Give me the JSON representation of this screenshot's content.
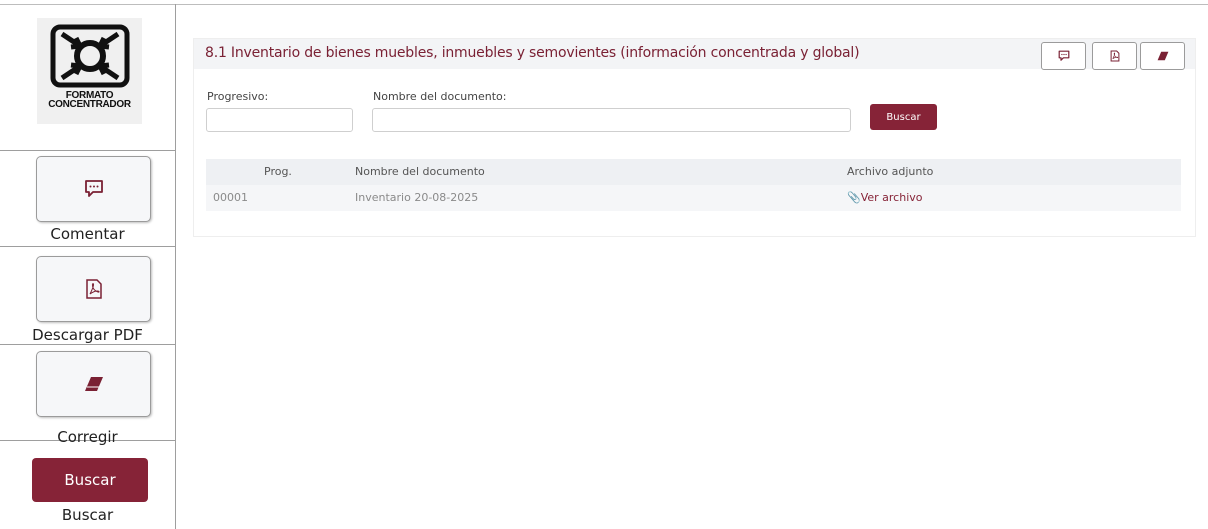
{
  "legend": {
    "logo_lines": [
      "FORMATO",
      "CONCENTRADOR"
    ],
    "comment": {
      "label": "Comentar",
      "icon": "comment-icon"
    },
    "pdf": {
      "label": "Descargar PDF",
      "icon": "pdf-icon"
    },
    "correct": {
      "label": "Corregir",
      "icon": "eraser-icon"
    },
    "search": {
      "button_label": "Buscar",
      "label": "Buscar"
    }
  },
  "panel": {
    "title": "8.1 Inventario de bienes muebles, inmuebles y semovientes (información concentrada y global)",
    "header_buttons": [
      "comment-icon",
      "pdf-icon",
      "eraser-icon"
    ]
  },
  "filters": {
    "progresivo_label": "Progresivo:",
    "progresivo_value": "",
    "nombre_label": "Nombre del documento:",
    "nombre_value": "",
    "search_label": "Buscar"
  },
  "table": {
    "columns": [
      "Prog.",
      "Nombre del documento",
      "Archivo adjunto"
    ],
    "rows": [
      {
        "prog": "00001",
        "nombre": "Inventario 20-08-2025",
        "archivo": "📎Ver archivo"
      }
    ]
  },
  "colors": {
    "accent": "#862337",
    "title": "#7a2134",
    "header_bg": "#f3f4f6",
    "icon": "#7a2134"
  }
}
